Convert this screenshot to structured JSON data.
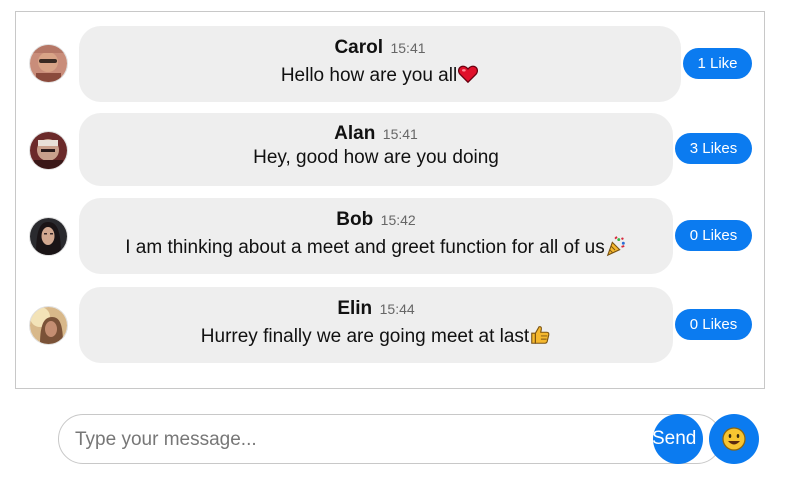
{
  "messages": [
    {
      "sender": "Carol",
      "time": "15:41",
      "text": "Hello how are you all",
      "emoji": "heart-icon",
      "likes": "1 Like"
    },
    {
      "sender": "Alan",
      "time": "15:41",
      "text": "Hey, good how are you doing",
      "emoji": "",
      "likes": "3 Likes"
    },
    {
      "sender": "Bob",
      "time": "15:42",
      "text": "I am thinking about a meet and greet function for all of us",
      "emoji": "party-popper-icon",
      "likes": "0 Likes"
    },
    {
      "sender": "Elin",
      "time": "15:44",
      "text": "Hurrey finally we are going meet at last",
      "emoji": "thumbs-up-icon",
      "likes": "0 Likes"
    }
  ],
  "composer": {
    "placeholder": "Type your message...",
    "send_label": "Send",
    "emoji_button_icon": "smiley-icon"
  },
  "colors": {
    "accent": "#0b7bf0",
    "bubble": "#eeeeee",
    "border": "#c8c8c8"
  }
}
